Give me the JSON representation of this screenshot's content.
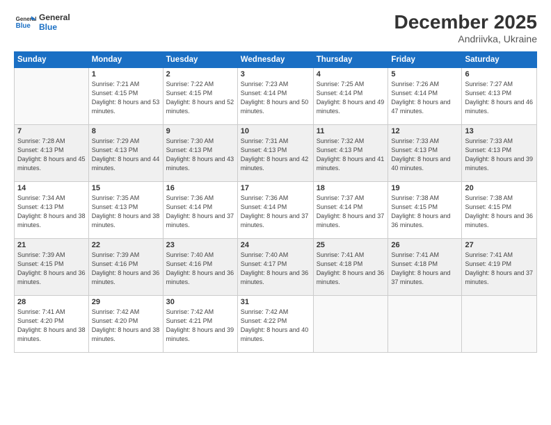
{
  "header": {
    "logo_line1": "General",
    "logo_line2": "Blue",
    "month": "December 2025",
    "location": "Andriivka, Ukraine"
  },
  "weekdays": [
    "Sunday",
    "Monday",
    "Tuesday",
    "Wednesday",
    "Thursday",
    "Friday",
    "Saturday"
  ],
  "weeks": [
    [
      {
        "day": "",
        "sunrise": "",
        "sunset": "",
        "daylight": ""
      },
      {
        "day": "1",
        "sunrise": "7:21 AM",
        "sunset": "4:15 PM",
        "daylight": "8 hours and 53 minutes."
      },
      {
        "day": "2",
        "sunrise": "7:22 AM",
        "sunset": "4:15 PM",
        "daylight": "8 hours and 52 minutes."
      },
      {
        "day": "3",
        "sunrise": "7:23 AM",
        "sunset": "4:14 PM",
        "daylight": "8 hours and 50 minutes."
      },
      {
        "day": "4",
        "sunrise": "7:25 AM",
        "sunset": "4:14 PM",
        "daylight": "8 hours and 49 minutes."
      },
      {
        "day": "5",
        "sunrise": "7:26 AM",
        "sunset": "4:14 PM",
        "daylight": "8 hours and 47 minutes."
      },
      {
        "day": "6",
        "sunrise": "7:27 AM",
        "sunset": "4:13 PM",
        "daylight": "8 hours and 46 minutes."
      }
    ],
    [
      {
        "day": "7",
        "sunrise": "7:28 AM",
        "sunset": "4:13 PM",
        "daylight": "8 hours and 45 minutes."
      },
      {
        "day": "8",
        "sunrise": "7:29 AM",
        "sunset": "4:13 PM",
        "daylight": "8 hours and 44 minutes."
      },
      {
        "day": "9",
        "sunrise": "7:30 AM",
        "sunset": "4:13 PM",
        "daylight": "8 hours and 43 minutes."
      },
      {
        "day": "10",
        "sunrise": "7:31 AM",
        "sunset": "4:13 PM",
        "daylight": "8 hours and 42 minutes."
      },
      {
        "day": "11",
        "sunrise": "7:32 AM",
        "sunset": "4:13 PM",
        "daylight": "8 hours and 41 minutes."
      },
      {
        "day": "12",
        "sunrise": "7:33 AM",
        "sunset": "4:13 PM",
        "daylight": "8 hours and 40 minutes."
      },
      {
        "day": "13",
        "sunrise": "7:33 AM",
        "sunset": "4:13 PM",
        "daylight": "8 hours and 39 minutes."
      }
    ],
    [
      {
        "day": "14",
        "sunrise": "7:34 AM",
        "sunset": "4:13 PM",
        "daylight": "8 hours and 38 minutes."
      },
      {
        "day": "15",
        "sunrise": "7:35 AM",
        "sunset": "4:13 PM",
        "daylight": "8 hours and 38 minutes."
      },
      {
        "day": "16",
        "sunrise": "7:36 AM",
        "sunset": "4:14 PM",
        "daylight": "8 hours and 37 minutes."
      },
      {
        "day": "17",
        "sunrise": "7:36 AM",
        "sunset": "4:14 PM",
        "daylight": "8 hours and 37 minutes."
      },
      {
        "day": "18",
        "sunrise": "7:37 AM",
        "sunset": "4:14 PM",
        "daylight": "8 hours and 37 minutes."
      },
      {
        "day": "19",
        "sunrise": "7:38 AM",
        "sunset": "4:15 PM",
        "daylight": "8 hours and 36 minutes."
      },
      {
        "day": "20",
        "sunrise": "7:38 AM",
        "sunset": "4:15 PM",
        "daylight": "8 hours and 36 minutes."
      }
    ],
    [
      {
        "day": "21",
        "sunrise": "7:39 AM",
        "sunset": "4:15 PM",
        "daylight": "8 hours and 36 minutes."
      },
      {
        "day": "22",
        "sunrise": "7:39 AM",
        "sunset": "4:16 PM",
        "daylight": "8 hours and 36 minutes."
      },
      {
        "day": "23",
        "sunrise": "7:40 AM",
        "sunset": "4:16 PM",
        "daylight": "8 hours and 36 minutes."
      },
      {
        "day": "24",
        "sunrise": "7:40 AM",
        "sunset": "4:17 PM",
        "daylight": "8 hours and 36 minutes."
      },
      {
        "day": "25",
        "sunrise": "7:41 AM",
        "sunset": "4:18 PM",
        "daylight": "8 hours and 36 minutes."
      },
      {
        "day": "26",
        "sunrise": "7:41 AM",
        "sunset": "4:18 PM",
        "daylight": "8 hours and 37 minutes."
      },
      {
        "day": "27",
        "sunrise": "7:41 AM",
        "sunset": "4:19 PM",
        "daylight": "8 hours and 37 minutes."
      }
    ],
    [
      {
        "day": "28",
        "sunrise": "7:41 AM",
        "sunset": "4:20 PM",
        "daylight": "8 hours and 38 minutes."
      },
      {
        "day": "29",
        "sunrise": "7:42 AM",
        "sunset": "4:20 PM",
        "daylight": "8 hours and 38 minutes."
      },
      {
        "day": "30",
        "sunrise": "7:42 AM",
        "sunset": "4:21 PM",
        "daylight": "8 hours and 39 minutes."
      },
      {
        "day": "31",
        "sunrise": "7:42 AM",
        "sunset": "4:22 PM",
        "daylight": "8 hours and 40 minutes."
      },
      {
        "day": "",
        "sunrise": "",
        "sunset": "",
        "daylight": ""
      },
      {
        "day": "",
        "sunrise": "",
        "sunset": "",
        "daylight": ""
      },
      {
        "day": "",
        "sunrise": "",
        "sunset": "",
        "daylight": ""
      }
    ]
  ]
}
